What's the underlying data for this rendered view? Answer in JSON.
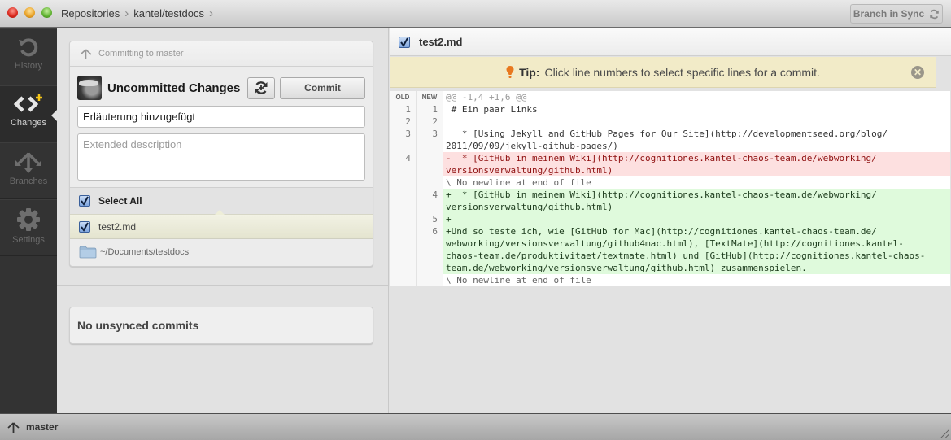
{
  "titlebar": {
    "breadcrumbs": [
      "Repositories",
      "kantel/testdocs"
    ],
    "sync_button": "Branch in Sync"
  },
  "nav": {
    "items": [
      {
        "label": "History",
        "icon": "history-icon",
        "active": false
      },
      {
        "label": "Changes",
        "icon": "changes-icon",
        "active": true
      },
      {
        "label": "Branches",
        "icon": "branches-icon",
        "active": false
      },
      {
        "label": "Settings",
        "icon": "gear-icon",
        "active": false
      }
    ]
  },
  "commit": {
    "header": "Committing to master",
    "title": "Uncommitted Changes",
    "commit_button": "Commit",
    "summary_value": "Erläuterung hinzugefügt",
    "description_placeholder": "Extended description",
    "select_all": "Select All",
    "files": [
      {
        "name": "test2.md",
        "checked": true
      }
    ],
    "path": "~/Documents/testdocs"
  },
  "unsynced": {
    "text": "No unsynced commits"
  },
  "diff": {
    "file_name": "test2.md",
    "tip_label": "Tip:",
    "tip_text": "Click line numbers to select specific lines for a commit.",
    "col_old": "OLD",
    "col_new": "NEW",
    "lines": [
      {
        "type": "hunk",
        "old": "",
        "new": "",
        "text": "@@ -1,4 +1,6 @@"
      },
      {
        "type": "ctx",
        "old": "1",
        "new": "1",
        "text": " # Ein paar Links"
      },
      {
        "type": "ctx",
        "old": "2",
        "new": "2",
        "text": " "
      },
      {
        "type": "ctx",
        "old": "3",
        "new": "3",
        "text": "   * [Using Jekyll and GitHub Pages for Our Site](http://developmentseed.org/blog/"
      },
      {
        "type": "ctx",
        "old": "",
        "new": "",
        "text": "2011/09/09/jekyll-github-pages/)"
      },
      {
        "type": "del",
        "old": "4",
        "new": "",
        "text": "-  * [GitHub in meinem Wiki](http://cognitiones.kantel-chaos-team.de/webworking/"
      },
      {
        "type": "del",
        "old": "",
        "new": "",
        "text": "versionsverwaltung/github.html)"
      },
      {
        "type": "meta",
        "old": "",
        "new": "",
        "text": "\\ No newline at end of file"
      },
      {
        "type": "add",
        "old": "",
        "new": "4",
        "text": "+  * [GitHub in meinem Wiki](http://cognitiones.kantel-chaos-team.de/webworking/"
      },
      {
        "type": "add",
        "old": "",
        "new": "",
        "text": "versionsverwaltung/github.html)"
      },
      {
        "type": "add",
        "old": "",
        "new": "5",
        "text": "+"
      },
      {
        "type": "add",
        "old": "",
        "new": "6",
        "text": "+Und so teste ich, wie [GitHub for Mac](http://cognitiones.kantel-chaos-team.de/"
      },
      {
        "type": "add",
        "old": "",
        "new": "",
        "text": "webworking/versionsverwaltung/github4mac.html), [TextMate](http://cognitiones.kantel-"
      },
      {
        "type": "add",
        "old": "",
        "new": "",
        "text": "chaos-team.de/produktivitaet/textmate.html) und [GitHub](http://cognitiones.kantel-chaos-"
      },
      {
        "type": "add",
        "old": "",
        "new": "",
        "text": "team.de/webworking/versionsverwaltung/github.html) zusammenspielen."
      },
      {
        "type": "meta",
        "old": "",
        "new": "",
        "text": "\\ No newline at end of file"
      }
    ]
  },
  "statusbar": {
    "branch": "master"
  }
}
